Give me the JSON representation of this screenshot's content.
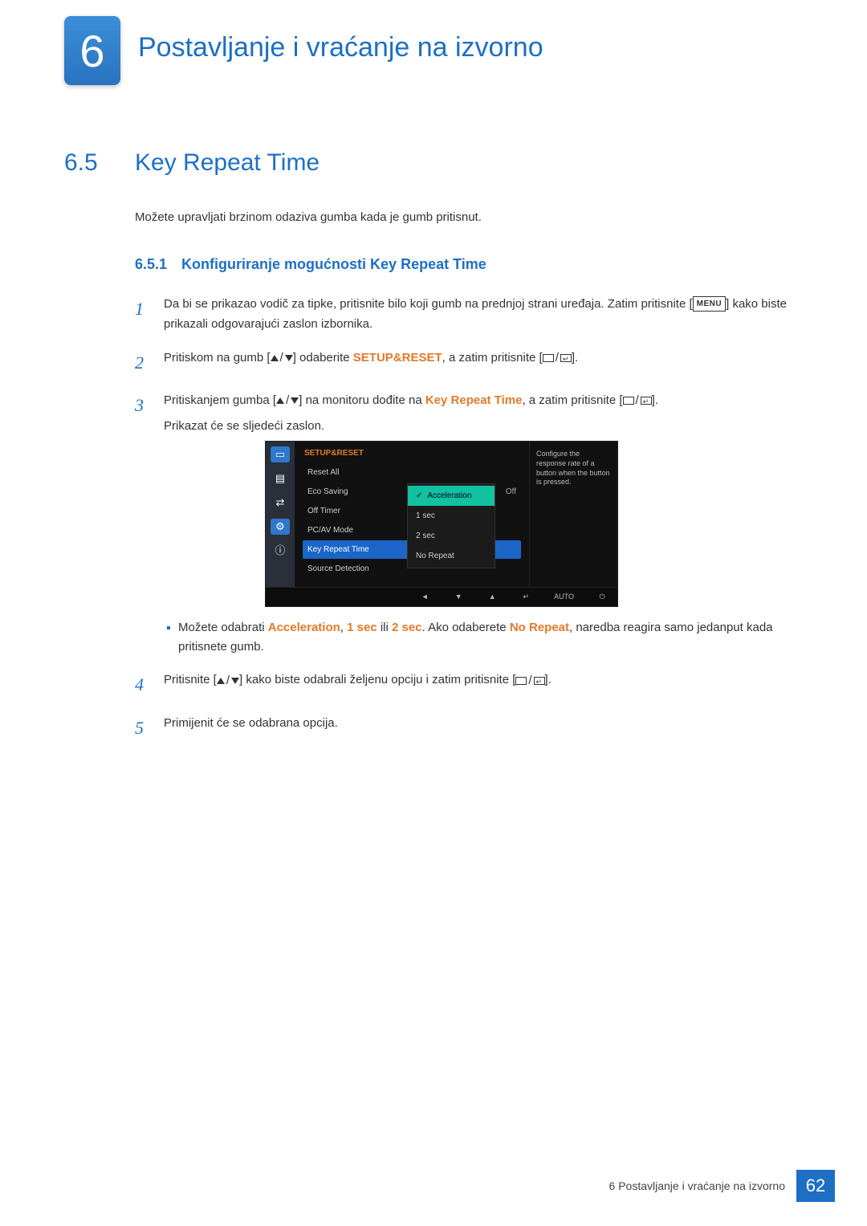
{
  "chapter": {
    "number": "6",
    "title": "Postavljanje i vraćanje na izvorno"
  },
  "section": {
    "number": "6.5",
    "title": "Key Repeat Time"
  },
  "intro": "Možete upravljati brzinom odaziva gumba kada je gumb pritisnut.",
  "subsection": {
    "number": "6.5.1",
    "title": "Konfiguriranje mogućnosti Key Repeat Time"
  },
  "steps": {
    "1": {
      "a": "Da bi se prikazao vodič za tipke, pritisnite bilo koji gumb na prednjoj strani uređaja. Zatim pritisnite [",
      "menu": "MENU",
      "b": "] kako biste prikazali odgovarajući zaslon izbornika."
    },
    "2": {
      "a": "Pritiskom na gumb [",
      "b": "] odaberite ",
      "kw": "SETUP&RESET",
      "c": ", a zatim pritisnite [",
      "d": "]."
    },
    "3": {
      "a": "Pritiskanjem gumba [",
      "b": "] na monitoru dođite na ",
      "kw": "Key Repeat Time",
      "c": ", a zatim pritisnite [",
      "d": "].",
      "e": "Prikazat će se sljedeći zaslon."
    },
    "3b": {
      "a": "Možete odabrati ",
      "k1": "Acceleration",
      "s1": ", ",
      "k2": "1 sec",
      "s2": " ili ",
      "k3": "2 sec",
      "b": ". Ako odaberete ",
      "k4": "No Repeat",
      "c": ", naredba reagira samo jedanput kada pritisnete gumb."
    },
    "4": {
      "a": "Pritisnite [",
      "b": "] kako biste odabrali željenu opciju i zatim pritisnite [",
      "c": "]."
    },
    "5": "Primijenit će se odabrana opcija."
  },
  "osd": {
    "heading": "SETUP&RESET",
    "items": [
      {
        "label": "Reset All",
        "value": ""
      },
      {
        "label": "Eco Saving",
        "value": "Off"
      },
      {
        "label": "Off Timer",
        "value": ""
      },
      {
        "label": "PC/AV Mode",
        "value": ""
      },
      {
        "label": "Key Repeat Time",
        "value": "",
        "selected": true
      },
      {
        "label": "Source Detection",
        "value": ""
      }
    ],
    "popup": [
      "Acceleration",
      "1 sec",
      "2 sec",
      "No Repeat"
    ],
    "desc": "Configure the response rate of a button when the button is pressed.",
    "footer_auto": "AUTO"
  },
  "footer": {
    "text": "6 Postavljanje i vraćanje na izvorno",
    "page": "62"
  }
}
